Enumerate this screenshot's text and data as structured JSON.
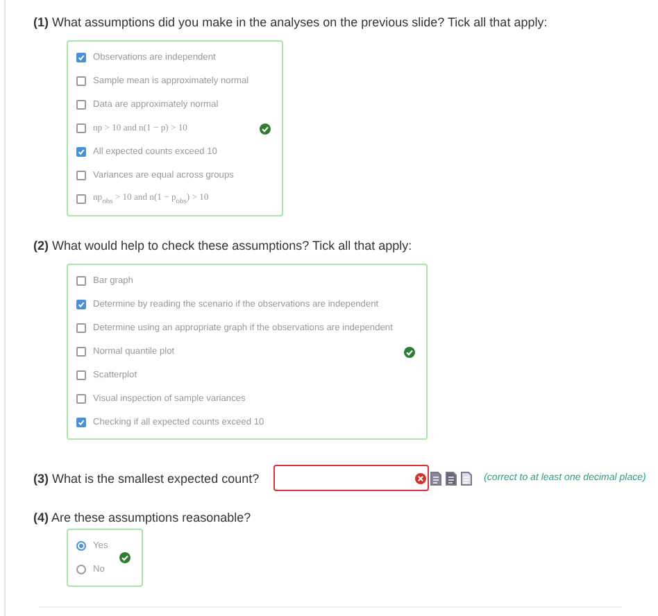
{
  "questions": [
    {
      "kind": "checkbox",
      "number": "(1)",
      "prompt": "What assumptions did you make in the analyses on the previous slide? Tick all that apply:",
      "correct": true,
      "options": [
        {
          "label": "Observations are independent",
          "checked": true
        },
        {
          "label": "Sample mean is approximately normal",
          "checked": false
        },
        {
          "label": "Data are approximately normal",
          "checked": false
        },
        {
          "label": "np > 10 and n(1 − p) > 10",
          "checked": false
        },
        {
          "label": "All expected counts exceed 10",
          "checked": true
        },
        {
          "label": "Variances are equal across groups",
          "checked": false
        },
        {
          "label": "np$_{obs}$ > 10 and n(1 − p$_{obs}$) > 10",
          "checked": false
        }
      ]
    },
    {
      "kind": "checkbox",
      "number": "(2)",
      "prompt": "What would help to check these assumptions? Tick all that apply:",
      "correct": true,
      "options": [
        {
          "label": "Bar graph",
          "checked": false
        },
        {
          "label": "Determine by reading the scenario if the observations are independent",
          "checked": true
        },
        {
          "label": "Determine using an appropriate graph if the observations are independent",
          "checked": false
        },
        {
          "label": "Normal quantile plot",
          "checked": false
        },
        {
          "label": "Scatterplot",
          "checked": false
        },
        {
          "label": "Visual inspection of sample variances",
          "checked": false
        },
        {
          "label": "Checking if all expected counts exceed 10",
          "checked": true
        }
      ]
    },
    {
      "kind": "input",
      "number": "(3)",
      "prompt": "What is the smallest expected count?",
      "correct": false,
      "hint": "(correct to at least one decimal place)"
    },
    {
      "kind": "radio",
      "number": "(4)",
      "prompt": "Are these assumptions reasonable?",
      "correct": true,
      "options": [
        {
          "label": "Yes",
          "selected": true
        },
        {
          "label": "No",
          "selected": false
        }
      ]
    }
  ]
}
